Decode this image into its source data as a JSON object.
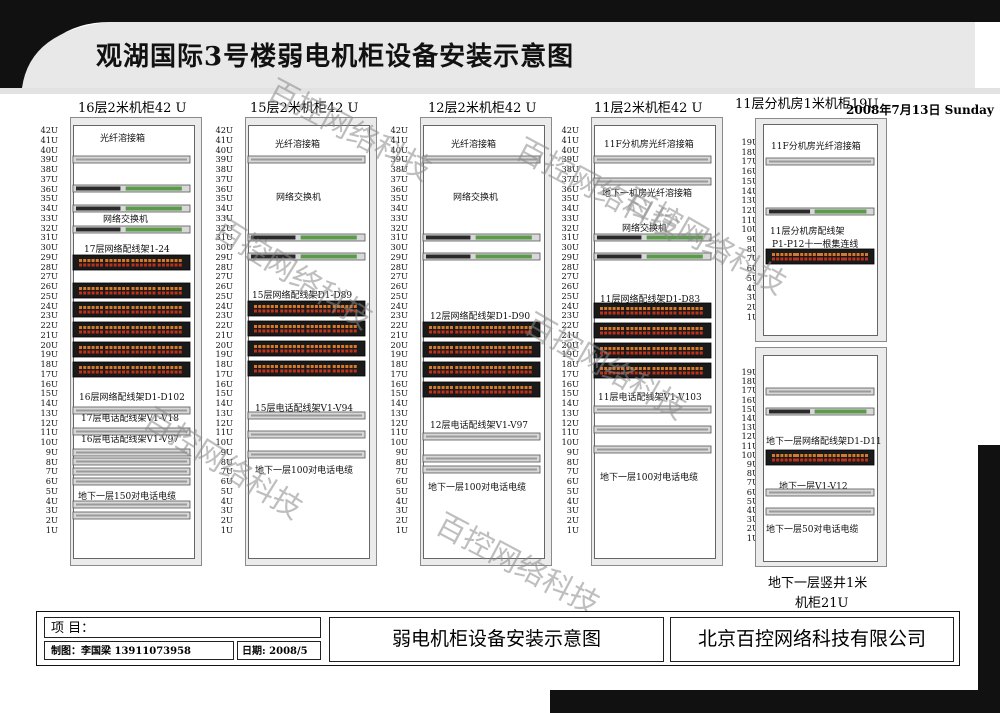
{
  "title": "观湖国际3号楼弱电机柜设备安装示意图",
  "date": "2008年7月13日 Sunday",
  "watermark": "百控网络科技",
  "cabinets": [
    {
      "name": "16层2米机柜42 U",
      "labels": [
        "光纤溶接箱",
        "网络交换机",
        "17层网络配线架1-24",
        "16层网络配线架D1-D102",
        "17层电话配线架V1-V18",
        "16层电话配线架V1-V97",
        "地下一层150对电话电缆"
      ]
    },
    {
      "name": "15层2米机柜42 U",
      "labels": [
        "光纤溶接箱",
        "网络交换机",
        "15层网络配线架D1-D89",
        "15层电话配线架V1-V94",
        "地下一层100对电话电缆"
      ]
    },
    {
      "name": "12层2米机柜42 U",
      "labels": [
        "光纤溶接箱",
        "网络交换机",
        "12层网络配线架D1-D90",
        "12层电话配线架V1-V97",
        "地下一层100对电话电缆"
      ]
    },
    {
      "name": "11层2米机柜42 U",
      "labels": [
        "11F分机房光纤溶接箱",
        "地下一机房光纤溶接箱",
        "网络交换机",
        "11层网络配线架D1-D83",
        "11层电话配线架V1-V103",
        "地下一层100对电话电缆"
      ]
    }
  ],
  "units42": [
    "42U",
    "41U",
    "40U",
    "39U",
    "38U",
    "37U",
    "36U",
    "35U",
    "34U",
    "33U",
    "32U",
    "31U",
    "30U",
    "29U",
    "28U",
    "27U",
    "26U",
    "25U",
    "24U",
    "23U",
    "22U",
    "21U",
    "20U",
    "19U",
    "18U",
    "17U",
    "16U",
    "15U",
    "14U",
    "13U",
    "12U",
    "11U",
    "10U",
    "9U",
    "8U",
    "7U",
    "6U",
    "5U",
    "4U",
    "3U",
    "2U",
    "1U"
  ],
  "units19": [
    "19U",
    "18U",
    "17U",
    "16U",
    "15U",
    "14U",
    "13U",
    "12U",
    "11U",
    "10U",
    "9U",
    "8U",
    "7U",
    "6U",
    "5U",
    "4U",
    "3U",
    "2U",
    "1U"
  ],
  "side_top": {
    "name": "11层分机房1米机柜19U",
    "labels": [
      "11F分机房光纤溶接箱",
      "11层分机房配线架",
      "P1-P12十一根集连线"
    ]
  },
  "side_bottom": {
    "labels": [
      "地下一层网络配线架D1-D11",
      "地下一层V1-V12",
      "地下一层50对电话电缆"
    ],
    "caption_line1": "地下一层竖井1米",
    "caption_line2": "机柜21U"
  },
  "title_block": {
    "project_label": "项 目：",
    "maker": "制图：李国梁    13911073958",
    "date": "日期: 2008/5",
    "drawing_title": "弱电机柜设备安装示意图",
    "company": "北京百控网络科技有限公司"
  },
  "colors": {
    "dark": "#1a1a1a",
    "gray": "#d6d6d6",
    "red": "#c0301a",
    "orange": "#d57a2a",
    "green": "#5a9a4a"
  }
}
